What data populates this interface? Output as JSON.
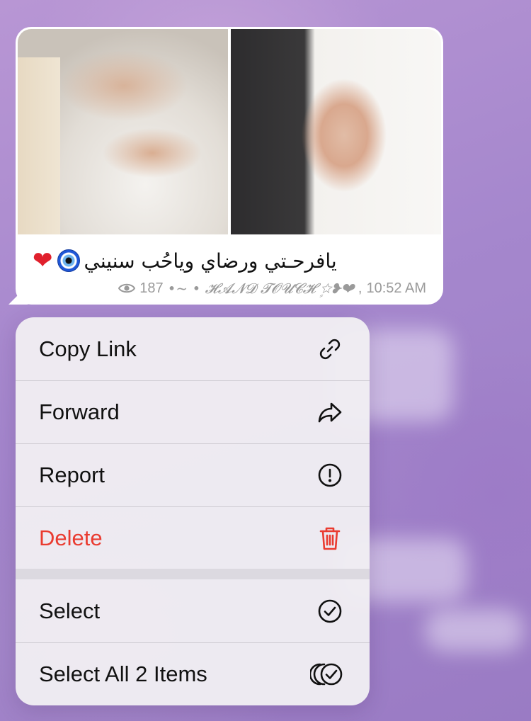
{
  "message": {
    "caption": "يافرحـتي ورضاي وياحُب سنيني",
    "caption_emojis": [
      "red-heart",
      "nazar-amulet"
    ],
    "views": "187",
    "signature": "•~ • 𝓗𝓐𝓝𝓓 𝓣𝓞𝓤𝓒𝓗 ☆ٍ❥❤",
    "time": "10:52 AM"
  },
  "menu": {
    "items": [
      {
        "label": "Copy Link",
        "icon": "link-icon"
      },
      {
        "label": "Forward",
        "icon": "forward-arrow-icon"
      },
      {
        "label": "Report",
        "icon": "exclamation-circle-icon"
      },
      {
        "label": "Delete",
        "icon": "trash-icon",
        "color": "#ea3b30"
      },
      {
        "label": "Select",
        "icon": "checkmark-circle-icon"
      },
      {
        "label": "Select All 2 Items",
        "icon": "multi-select-icon"
      }
    ]
  },
  "colors": {
    "danger": "#ea3b30",
    "bubble": "#ffffff",
    "meta_text": "#9a9a9a"
  }
}
